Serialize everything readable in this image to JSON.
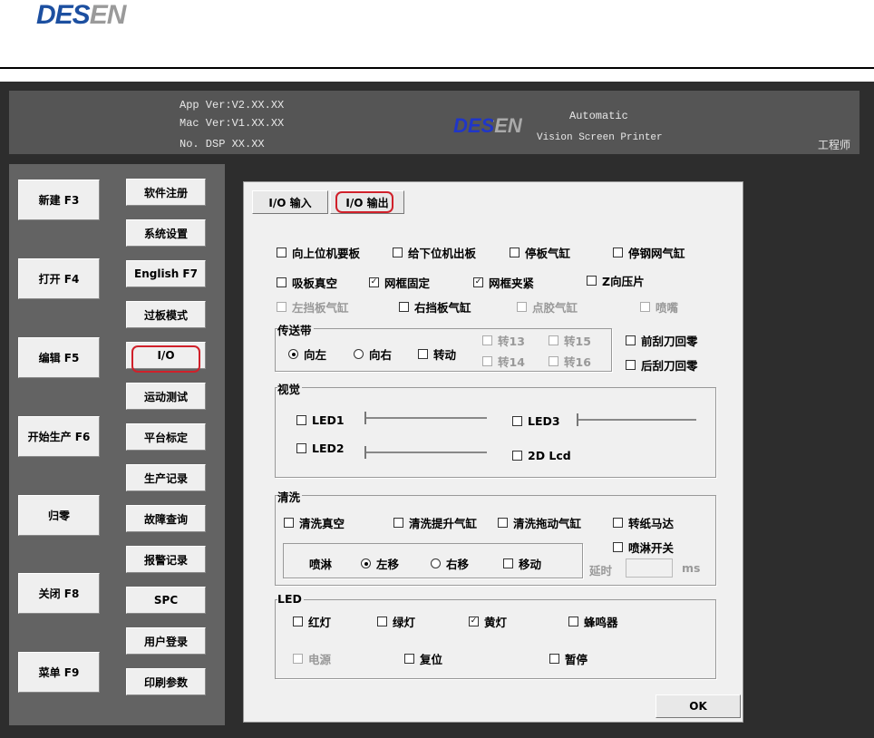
{
  "logo": "DESEN",
  "header": {
    "app_ver": "App Ver:V2.XX.XX",
    "mac_ver": "Mac Ver:V1.XX.XX",
    "dsp": "No. DSP XX.XX",
    "brand": "DESEN",
    "line1": "Automatic",
    "line2": "Vision Screen Printer",
    "user": "工程师"
  },
  "left_buttons": [
    "新建 F3",
    "打开 F4",
    "编辑 F5",
    "开始生产 F6",
    "归零",
    "关闭 F8",
    "菜单 F9"
  ],
  "right_buttons": [
    "软件注册",
    "系统设置",
    "English F7",
    "过板模式",
    "I/O",
    "运动测试",
    "平台标定",
    "生产记录",
    "故障查询",
    "报警记录",
    "SPC",
    "用户登录",
    "印刷参数"
  ],
  "tabs": [
    "I/O 输入",
    "I/O 输出"
  ],
  "outputs": [
    {
      "label": "向上位机要板",
      "checked": false
    },
    {
      "label": "给下位机出板",
      "checked": false
    },
    {
      "label": "停板气缸",
      "checked": false
    },
    {
      "label": "停钢网气缸",
      "checked": false
    },
    {
      "label": "吸板真空",
      "checked": false
    },
    {
      "label": "网框固定",
      "checked": true
    },
    {
      "label": "网框夹紧",
      "checked": true
    },
    {
      "label": "Z向压片",
      "checked": false
    },
    {
      "label": "左挡板气缸",
      "checked": false,
      "disabled": true
    },
    {
      "label": "右挡板气缸",
      "checked": false
    },
    {
      "label": "点胶气缸",
      "checked": false,
      "disabled": true
    },
    {
      "label": "喷嘴",
      "checked": false,
      "disabled": true
    }
  ],
  "conveyor": {
    "title": "传送带",
    "left": "向左",
    "right": "向右",
    "rotate": "转动",
    "t13": "转13",
    "t14": "转14",
    "t15": "转15",
    "t16": "转16",
    "front": "前刮刀回零",
    "back": "后刮刀回零",
    "direction": "left"
  },
  "vision": {
    "title": "视觉",
    "led1": "LED1",
    "led2": "LED2",
    "led3": "LED3",
    "lcd": "2D Lcd",
    "led1_level": 0,
    "led2_level": 0,
    "led3_level": 0
  },
  "clean": {
    "title": "清洗",
    "vacuum": "清洗真空",
    "lift": "清洗提升气缸",
    "drag": "清洗拖动气缸",
    "paper": "转纸马达",
    "spray_switch": "喷淋开关",
    "spray": "喷淋",
    "move_left": "左移",
    "move_right": "右移",
    "move": "移动",
    "delay_label": "延时",
    "delay_value": "",
    "unit": "ms",
    "direction": "left"
  },
  "led": {
    "title": "LED",
    "red": "红灯",
    "green": "绿灯",
    "yellow": "黄灯",
    "buzzer": "蜂鸣器",
    "power": "电源",
    "reset": "复位",
    "pause": "暂停",
    "yellow_checked": true
  },
  "ok": "OK"
}
